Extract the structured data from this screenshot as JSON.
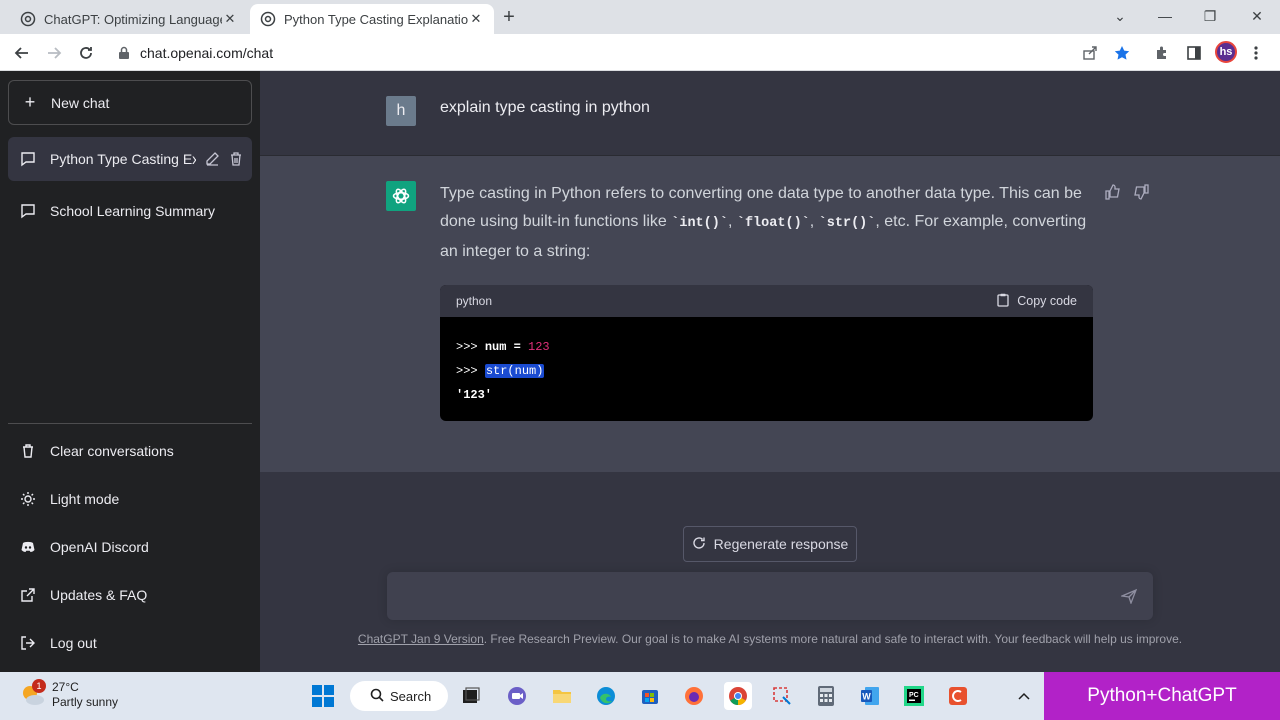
{
  "browser": {
    "tabs": [
      {
        "title": "ChatGPT: Optimizing Language M",
        "active": false
      },
      {
        "title": "Python Type Casting Explanation",
        "active": true
      }
    ],
    "url": "chat.openai.com/chat",
    "profile_initials": "hs"
  },
  "sidebar": {
    "new_chat": "New chat",
    "conversations": [
      {
        "label": "Python Type Casting Ex",
        "active": true
      },
      {
        "label": "School Learning Summary",
        "active": false
      }
    ],
    "menu": {
      "clear": "Clear conversations",
      "light_mode": "Light mode",
      "discord": "OpenAI Discord",
      "faq": "Updates & FAQ",
      "logout": "Log out"
    }
  },
  "chat": {
    "user_initial": "h",
    "user_message": "explain type casting in python",
    "assistant": {
      "p1": "Type casting in Python refers to converting one data type to another data type. This can be done using built-in functions like ",
      "code1": "`int()`",
      "sep1": ", ",
      "code2": "`float()`",
      "sep2": ", ",
      "code3": "`str()`",
      "p2": ", etc. For example, converting an integer to a string:"
    },
    "code": {
      "language": "python",
      "copy_label": "Copy code",
      "prompt1": ">>> ",
      "line1_code": "num = ",
      "line1_num": "123",
      "prompt2": ">>> ",
      "line2_selected": "str(num)",
      "line3": "'123'"
    },
    "regenerate": "Regenerate response",
    "input_placeholder": "",
    "footer_link": "ChatGPT Jan 9 Version",
    "footer_text": ". Free Research Preview. Our goal is to make AI systems more natural and safe to interact with. Your feedback will help us improve."
  },
  "taskbar": {
    "temperature": "27°C",
    "condition": "Partly sunny",
    "notification_count": "1",
    "search_label": "Search",
    "brand_label": "Python+ChatGPT"
  },
  "colors": {
    "sidebar_bg": "#202123",
    "main_bg": "#343541",
    "assistant_bg": "#444654",
    "accent": "#10a37f",
    "brand": "#b222c8"
  }
}
